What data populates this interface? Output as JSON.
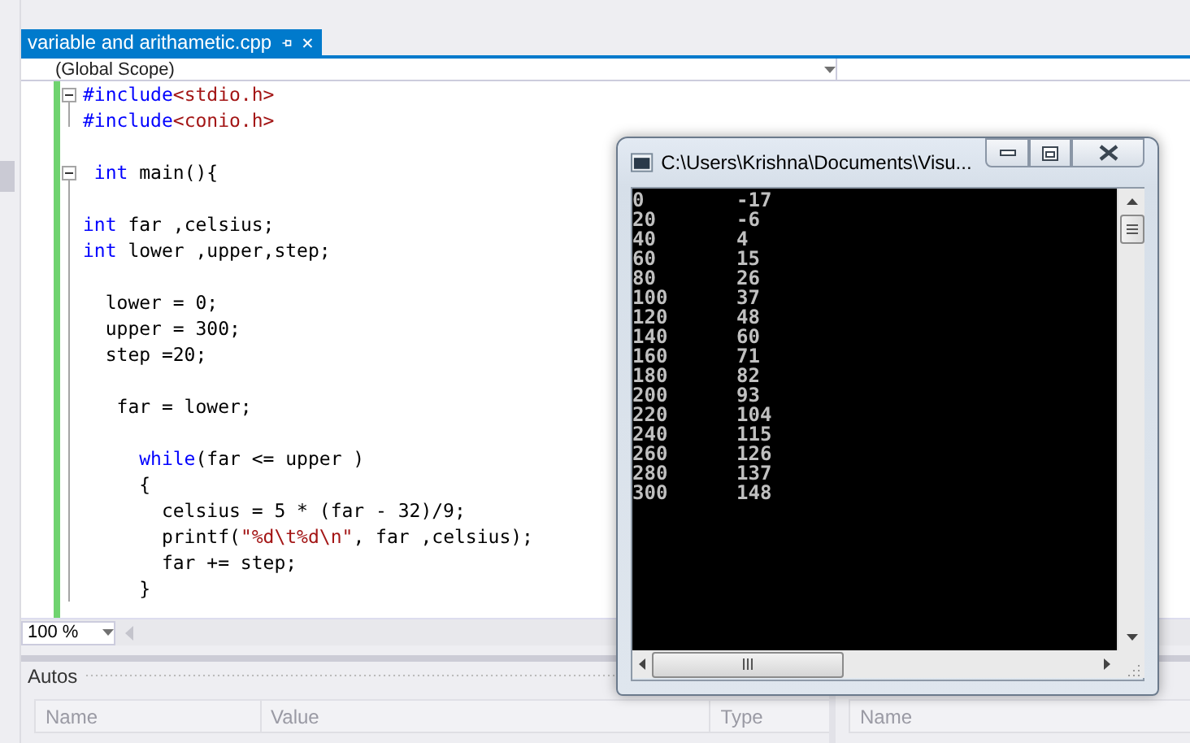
{
  "document_tab": {
    "title": "variable and arithametic.cpp",
    "selected": true
  },
  "scope_dropdown": {
    "value": "(Global Scope)"
  },
  "code_blocks": [
    {
      "collapsible": true,
      "lines": [
        {
          "tokens": [
            {
              "text": "#include",
              "kind": "keyword"
            },
            {
              "text": "<stdio.h>",
              "kind": "path"
            }
          ]
        },
        {
          "tokens": [
            {
              "text": "#include",
              "kind": "keyword"
            },
            {
              "text": "<conio.h>",
              "kind": "path"
            }
          ]
        }
      ]
    },
    {
      "collapsible": false,
      "lines": [
        {
          "blank": true
        }
      ]
    },
    {
      "collapsible": true,
      "lines": [
        {
          "tokens": [
            {
              "text": " int",
              "kind": "keyword"
            },
            {
              "text": " main(){",
              "kind": "plain"
            }
          ]
        },
        {
          "blank": true
        },
        {
          "tokens": [
            {
              "text": "int",
              "kind": "keyword"
            },
            {
              "text": " far ,celsius;",
              "kind": "plain"
            }
          ]
        },
        {
          "tokens": [
            {
              "text": "int",
              "kind": "keyword"
            },
            {
              "text": " lower ,upper,step;",
              "kind": "plain"
            }
          ]
        },
        {
          "blank": true
        },
        {
          "tokens": [
            {
              "text": "  lower = 0;",
              "kind": "plain"
            }
          ]
        },
        {
          "tokens": [
            {
              "text": "  upper = 300;",
              "kind": "plain"
            }
          ]
        },
        {
          "tokens": [
            {
              "text": "  step =20;",
              "kind": "plain"
            }
          ]
        },
        {
          "blank": true
        },
        {
          "tokens": [
            {
              "text": "   far = lower;",
              "kind": "plain"
            }
          ]
        },
        {
          "blank": true
        },
        {
          "tokens": [
            {
              "text": "     while",
              "kind": "keyword"
            },
            {
              "text": "(far <= upper )",
              "kind": "plain"
            }
          ]
        },
        {
          "tokens": [
            {
              "text": "     {",
              "kind": "plain"
            }
          ]
        },
        {
          "tokens": [
            {
              "text": "       celsius = 5 * (far - 32)/9;",
              "kind": "plain"
            }
          ]
        },
        {
          "tokens": [
            {
              "text": "       printf(",
              "kind": "plain"
            },
            {
              "text": "\"%d\\t%d\\n\"",
              "kind": "string"
            },
            {
              "text": ", far ,celsius);",
              "kind": "plain"
            }
          ]
        },
        {
          "tokens": [
            {
              "text": "       far += step;",
              "kind": "plain"
            }
          ]
        },
        {
          "tokens": [
            {
              "text": "     }",
              "kind": "plain"
            }
          ]
        }
      ]
    }
  ],
  "zoom": {
    "value": "100 %"
  },
  "autos": {
    "title": "Autos",
    "columns": [
      "Name",
      "Value",
      "Type"
    ]
  },
  "second_pane": {
    "columns": [
      "Name"
    ]
  },
  "console": {
    "title": "C:\\Users\\Krishna\\Documents\\Visu...",
    "rows": [
      [
        "0",
        "-17"
      ],
      [
        "20",
        "-6"
      ],
      [
        "40",
        "4"
      ],
      [
        "60",
        "15"
      ],
      [
        "80",
        "26"
      ],
      [
        "100",
        "37"
      ],
      [
        "120",
        "48"
      ],
      [
        "140",
        "60"
      ],
      [
        "160",
        "71"
      ],
      [
        "180",
        "82"
      ],
      [
        "200",
        "93"
      ],
      [
        "220",
        "104"
      ],
      [
        "240",
        "115"
      ],
      [
        "260",
        "126"
      ],
      [
        "280",
        "137"
      ],
      [
        "300",
        "148"
      ]
    ]
  }
}
